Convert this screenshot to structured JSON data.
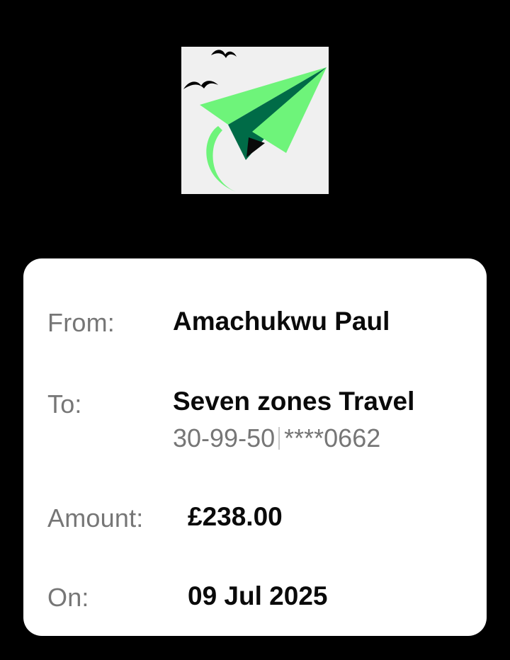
{
  "logo": {
    "icon": "paper-plane-icon",
    "colors": {
      "background": "#f0f0f0",
      "light_green": "#6ef47a",
      "dark_green": "#006b47",
      "birds": "#000000"
    }
  },
  "details": {
    "from": {
      "label": "From:",
      "value": "Amachukwu Paul"
    },
    "to": {
      "label": "To:",
      "value": "Seven zones Travel",
      "sort_code": "30-99-50",
      "account_masked": "****0662"
    },
    "amount": {
      "label": "Amount:",
      "value": "£238.00"
    },
    "on": {
      "label": "On:",
      "value": "09 Jul 2025"
    }
  }
}
